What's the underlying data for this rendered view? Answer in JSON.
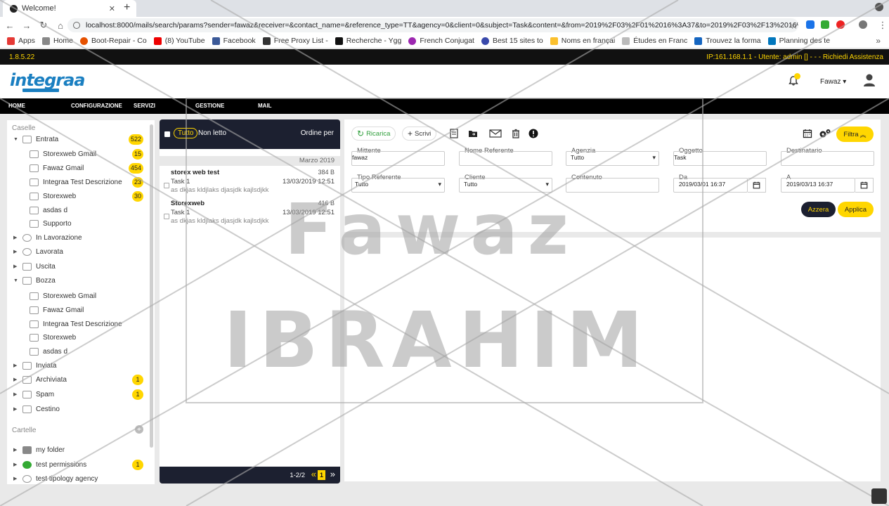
{
  "browser": {
    "tab_title": "Welcome!",
    "url": "localhost:8000/mails/search/params?sender=fawaz&receiver=&contact_name=&reference_type=TT&agency=0&client=0&subject=Task&content=&from=2019%2F03%2F01%2016%3A37&to=2019%2F03%2F13%2016%3A37",
    "bookmarks": [
      "Apps",
      "Home",
      "Boot-Repair - Co",
      "(8) YouTube",
      "Facebook",
      "Free Proxy List -",
      "Recherche - Ygg",
      "French Conjugat",
      "Best 15 sites to",
      "Noms en françai",
      "Études en Franc",
      "Trouvez la forma",
      "Planning des te"
    ],
    "bookmark_more": "»"
  },
  "app": {
    "version": "1.8.5.22",
    "session_info": "IP:161.168.1.1 - Utente: admin [] - - - Richiedi Assistenza",
    "logo_text": "integraa",
    "user_name": "Fawaz ▾",
    "nav": [
      "HOME",
      "CONFIGURAZIONE",
      "SERVIZI",
      "GESTIONE",
      "MAIL"
    ]
  },
  "sidebar": {
    "boxes_label": "Caselle",
    "folders_label": "Cartelle",
    "items": [
      {
        "label": "Entrata",
        "arrow": "▼",
        "badge": "522"
      },
      {
        "label": "Storexweb Gmail",
        "badge": "15"
      },
      {
        "label": "Fawaz Gmail",
        "badge": "454"
      },
      {
        "label": "Integraa Test Descrizione",
        "badge": "23"
      },
      {
        "label": "Storexweb",
        "badge": "30"
      },
      {
        "label": "asdas d"
      },
      {
        "label": "Supporto"
      },
      {
        "label": "In Lavorazione",
        "arrow": "▶"
      },
      {
        "label": "Lavorata",
        "arrow": "▶"
      },
      {
        "label": "Uscita",
        "arrow": "▶"
      },
      {
        "label": "Bozza",
        "arrow": "▼"
      },
      {
        "label": "Storexweb Gmail"
      },
      {
        "label": "Fawaz Gmail"
      },
      {
        "label": "Integraa Test Descrizione"
      },
      {
        "label": "Storexweb"
      },
      {
        "label": "asdas d"
      },
      {
        "label": "Inviata",
        "arrow": "▶"
      },
      {
        "label": "Archiviata",
        "arrow": "▶",
        "badge": "1"
      },
      {
        "label": "Spam",
        "arrow": "▶",
        "badge": "1"
      },
      {
        "label": "Cestino",
        "arrow": "▶"
      }
    ],
    "folders": [
      {
        "label": "my folder",
        "arrow": "▶"
      },
      {
        "label": "test permissions",
        "arrow": "▶",
        "badge": "1"
      },
      {
        "label": "test tipology agency",
        "arrow": "▶"
      }
    ]
  },
  "maillist": {
    "all_label": "Tutto",
    "unread_label": "Non letto",
    "order_label": "Ordine per",
    "month": "Marzo 2019",
    "mails": [
      {
        "from": "storex web test",
        "size": "384 B",
        "subject": "Task 1",
        "date": "13/03/2019 12:51",
        "preview": "as dkjas kldjlaks djasjdk kajlsdjkk"
      },
      {
        "from": "Storexweb",
        "size": "416 B",
        "subject": "Task 1",
        "date": "13/03/2019 12:51",
        "preview": "as dkjas kldjlaks djasjdk kajlsdjkk"
      }
    ],
    "pagination": "1-2/2",
    "page_prev": "«",
    "page_current": "1",
    "page_next": "»"
  },
  "toolbar": {
    "reload_label": "Ricarica",
    "compose_label": "Scrivi",
    "filter_label": "Filtra"
  },
  "filters": {
    "mittente_label": "Mittente",
    "mittente_value": "fawaz",
    "referente_label": "Nome Referente",
    "referente_value": "",
    "agenzia_label": "Agenzia",
    "agenzia_value": "Tutto",
    "oggetto_label": "Oggetto",
    "oggetto_value": "Task",
    "destinatario_label": "Destinatario",
    "destinatario_value": "",
    "tipo_label": "Tipo Referente",
    "tipo_value": "Tutto",
    "cliente_label": "Cliente",
    "cliente_value": "Tutto",
    "contenuto_label": "Contenuto",
    "contenuto_value": "",
    "da_label": "Da",
    "da_value": "2019/03/01 16:37",
    "a_label": "A",
    "a_value": "2019/03/13 16:37",
    "reset_label": "Azzera",
    "apply_label": "Applica"
  },
  "watermark": {
    "line1": "Fawaz",
    "line2": "IBRAHIM"
  }
}
